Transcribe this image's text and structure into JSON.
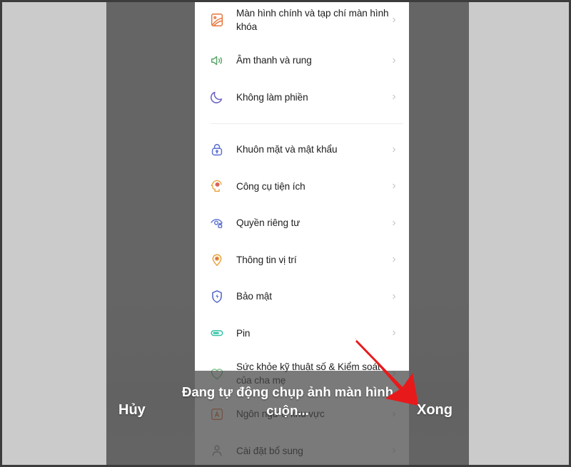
{
  "phone_settings": {
    "groups": [
      {
        "items": [
          {
            "label": "Màn hình chính và tạp chí màn hình khóa",
            "icon": "wallpaper-icon",
            "icon_color": "#e8743b",
            "chevron": "›"
          },
          {
            "label": "Âm thanh và rung",
            "icon": "speaker-icon",
            "icon_color": "#5aa469",
            "chevron": "›"
          },
          {
            "label": "Không làm phiền",
            "icon": "moon-icon",
            "icon_color": "#6b62c4",
            "chevron": "›"
          }
        ]
      },
      {
        "items": [
          {
            "label": "Khuôn mặt và mật khẩu",
            "icon": "lock-icon",
            "icon_color": "#5a6fd0",
            "chevron": "›"
          },
          {
            "label": "Công cụ tiện ích",
            "icon": "head-gear-icon",
            "icon_color": "#e8a33b",
            "chevron": "›"
          },
          {
            "label": "Quyền riêng tư",
            "icon": "privacy-eye-icon",
            "icon_color": "#5a6fd0",
            "chevron": "›"
          },
          {
            "label": "Thông tin vị trí",
            "icon": "location-pin-icon",
            "icon_color": "#e8a33b",
            "chevron": "›"
          },
          {
            "label": "Bảo mật",
            "icon": "shield-icon",
            "icon_color": "#4a5fc4",
            "chevron": "›"
          },
          {
            "label": "Pin",
            "icon": "battery-icon",
            "icon_color": "#2fc4a5",
            "chevron": "›"
          },
          {
            "label": "Sức khỏe kỹ thuật số & Kiểm soát của cha mẹ",
            "icon": "heart-icon",
            "icon_color": "#7fc48a",
            "chevron": "›"
          },
          {
            "label": "Ngôn ngữ & khu vực",
            "icon": "language-icon",
            "icon_color": "#e8743b",
            "chevron": "›"
          },
          {
            "label": "Cài đặt bổ sung",
            "icon": "person-icon",
            "icon_color": "#8f8f8f",
            "chevron": "›"
          }
        ]
      }
    ]
  },
  "capture_bar": {
    "cancel_label": "Hủy",
    "done_label": "Xong",
    "status_text": "Đang tự động chụp ảnh màn hình cuộn..."
  },
  "annotation": {
    "arrow_color": "#e8191b",
    "arrow_target": "Xong"
  }
}
